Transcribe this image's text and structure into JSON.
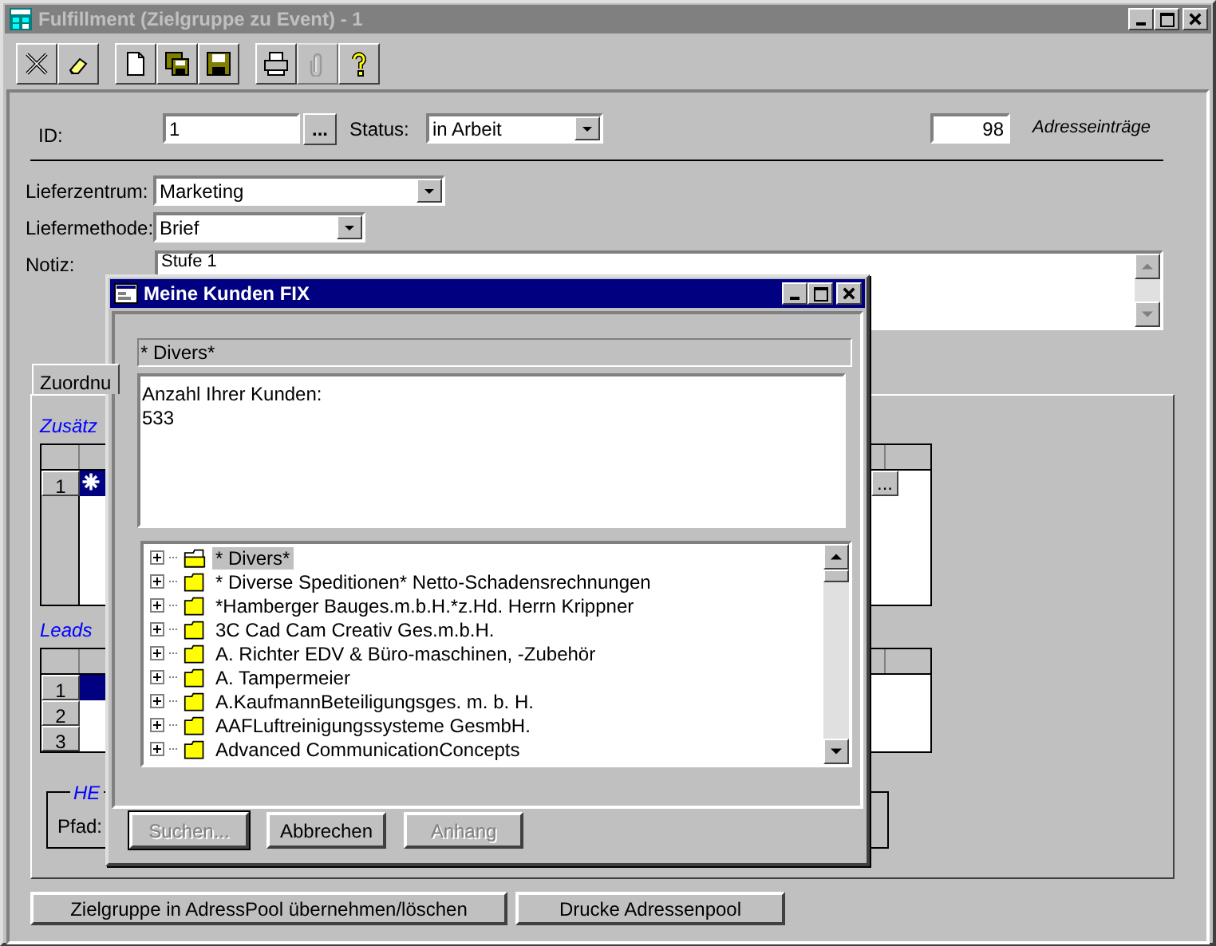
{
  "window": {
    "title": "Fulfillment (Zielgruppe zu Event) - 1",
    "active": false
  },
  "toolbar": [
    {
      "buttons": [
        {
          "kind": "cancel",
          "disabled": false
        },
        {
          "kind": "eraser",
          "disabled": false
        }
      ]
    },
    {
      "buttons": [
        {
          "kind": "new",
          "disabled": false
        },
        {
          "kind": "saveall",
          "disabled": false
        },
        {
          "kind": "save",
          "disabled": false
        }
      ]
    },
    {
      "buttons": [
        {
          "kind": "print",
          "disabled": false
        },
        {
          "kind": "attach",
          "disabled": true
        },
        {
          "kind": "help",
          "disabled": false
        }
      ]
    }
  ],
  "form": {
    "id": {
      "label": "ID:",
      "value": "1",
      "button": "..."
    },
    "status": {
      "label": "Status:",
      "value": "in Arbeit"
    },
    "count": {
      "value": "98",
      "label": "Adresseinträge"
    },
    "lieferzentrum": {
      "label": "Lieferzentrum:",
      "value": "Marketing"
    },
    "liefermethode": {
      "label": "Liefermethode:",
      "value": "Brief"
    },
    "notiz": {
      "label": "Notiz:",
      "value": "Stufe 1"
    }
  },
  "tabs": [
    {
      "label": "Zuordnu",
      "selected": true
    }
  ],
  "panel": {
    "section_1": "Zusätz",
    "grid_1": {
      "rows": [
        {
          "header": "1",
          "selected": true
        }
      ],
      "cell_button": "..."
    },
    "section_2": "Leads",
    "grid_2": {
      "rows": [
        {
          "header": "1",
          "selected": true
        },
        {
          "header": "2",
          "selected": false
        },
        {
          "header": "3",
          "selected": false
        }
      ]
    },
    "group": {
      "legend": "HE",
      "label": "Pfad:"
    }
  },
  "buttons": [
    "Zielgruppe in AdressPool übernehmen/löschen",
    "Drucke Adressenpool"
  ],
  "dialog": {
    "title": "Meine Kunden FIX",
    "active": true,
    "current": "* Divers*",
    "info": [
      "Anzahl Ihrer Kunden:",
      "533"
    ],
    "tree": [
      {
        "label": "* Divers*",
        "selected": true
      },
      {
        "label": "* Diverse Speditionen* Netto-Schadensrechnungen",
        "selected": false
      },
      {
        "label": "*Hamberger Bauges.m.b.H.*z.Hd. Herrn Krippner",
        "selected": false
      },
      {
        "label": "3C Cad Cam Creativ Ges.m.b.H.",
        "selected": false
      },
      {
        "label": "A. Richter EDV & Büro-maschinen, -Zubehör",
        "selected": false
      },
      {
        "label": "A. Tampermeier",
        "selected": false
      },
      {
        "label": "A.KaufmannBeteiligungsges. m. b. H.",
        "selected": false
      },
      {
        "label": "AAFLuftreinigungssysteme GesmbH.",
        "selected": false
      },
      {
        "label": "Advanced CommunicationConcepts",
        "selected": false
      }
    ],
    "buttons": [
      {
        "label": "Suchen...",
        "disabled": true
      },
      {
        "label": "Abbrechen",
        "disabled": false
      },
      {
        "label": "Anhang",
        "disabled": true
      }
    ]
  }
}
